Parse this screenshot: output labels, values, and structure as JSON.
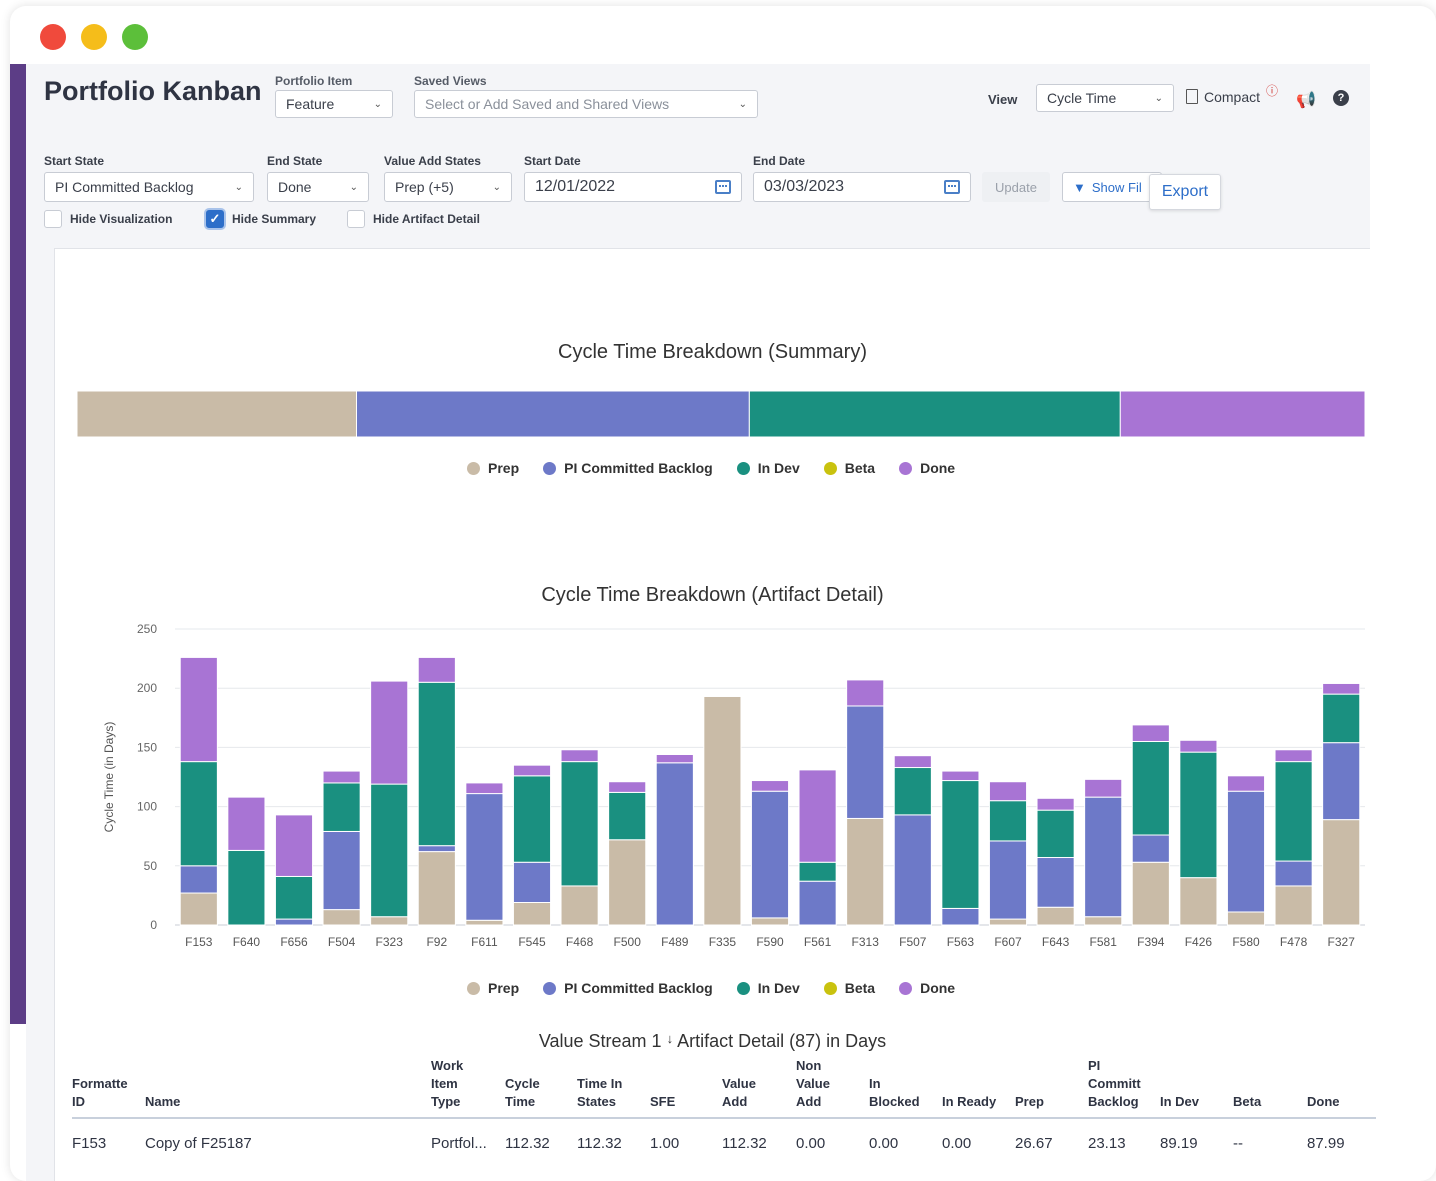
{
  "header": {
    "title": "Portfolio Kanban",
    "portfolio_item_label": "Portfolio Item",
    "portfolio_item_value": "Feature",
    "saved_views_label": "Saved Views",
    "saved_views_placeholder": "Select or Add Saved and Shared Views",
    "view_label": "View",
    "view_value": "Cycle Time",
    "compact_label": "Compact"
  },
  "filters": {
    "start_state_label": "Start State",
    "start_state_value": "PI Committed Backlog",
    "end_state_label": "End State",
    "end_state_value": "Done",
    "value_add_label": "Value Add States",
    "value_add_value": "Prep (+5)",
    "start_date_label": "Start Date",
    "start_date_value": "12/01/2022",
    "end_date_label": "End Date",
    "end_date_value": "03/03/2023",
    "update_label": "Update",
    "show_filters_label": "Show Fil",
    "export_label": "Export",
    "hide_visualization_label": "Hide Visualization",
    "hide_summary_label": "Hide Summary",
    "hide_artifact_label": "Hide Artifact Detail",
    "hide_visualization_checked": false,
    "hide_summary_checked": true,
    "hide_artifact_checked": false
  },
  "colors": {
    "prep": "#c9bba7",
    "pi_committed_backlog": "#6d79c8",
    "in_dev": "#1a9080",
    "beta": "#c9c20f",
    "done": "#a874d4"
  },
  "legend": [
    "Prep",
    "PI Committed Backlog",
    "In Dev",
    "Beta",
    "Done"
  ],
  "chart_data": [
    {
      "type": "bar",
      "title": "Cycle Time Breakdown (Summary)",
      "orientation": "horizontal-stacked-100",
      "series": [
        {
          "name": "Prep",
          "values": [
            21.7
          ]
        },
        {
          "name": "PI Committed Backlog",
          "values": [
            30.5
          ]
        },
        {
          "name": "In Dev",
          "values": [
            28.8
          ]
        },
        {
          "name": "Beta",
          "values": [
            0
          ]
        },
        {
          "name": "Done",
          "values": [
            19.0
          ]
        }
      ],
      "legend": "bottom"
    },
    {
      "type": "bar",
      "title": "Cycle Time Breakdown (Artifact Detail)",
      "ylabel": "Cycle Time (in Days)",
      "ylim": [
        0,
        250
      ],
      "yticks": [
        0,
        50,
        100,
        150,
        200,
        250
      ],
      "categories": [
        "F153",
        "F640",
        "F656",
        "F504",
        "F323",
        "F92",
        "F611",
        "F545",
        "F468",
        "F500",
        "F489",
        "F335",
        "F590",
        "F561",
        "F313",
        "F507",
        "F563",
        "F607",
        "F643",
        "F581",
        "F394",
        "F426",
        "F580",
        "F478",
        "F327"
      ],
      "series": [
        {
          "name": "Prep",
          "values": [
            27,
            0,
            0,
            13,
            7,
            62,
            4,
            19,
            33,
            72,
            0,
            193,
            6,
            0,
            90,
            0,
            0,
            5,
            15,
            7,
            53,
            40,
            11,
            33,
            89
          ]
        },
        {
          "name": "PI Committed Backlog",
          "values": [
            23,
            0,
            5,
            66,
            0,
            5,
            107,
            34,
            0,
            0,
            137,
            0,
            107,
            37,
            95,
            93,
            14,
            66,
            42,
            101,
            23,
            0,
            102,
            21,
            65
          ]
        },
        {
          "name": "In Dev",
          "values": [
            88,
            63,
            36,
            41,
            112,
            138,
            0,
            73,
            105,
            40,
            0,
            0,
            0,
            16,
            0,
            40,
            108,
            34,
            40,
            0,
            79,
            106,
            0,
            84,
            41
          ]
        },
        {
          "name": "Beta",
          "values": [
            0,
            0,
            0,
            0,
            0,
            0,
            0,
            0,
            0,
            0,
            0,
            0,
            0,
            0,
            0,
            0,
            0,
            0,
            0,
            0,
            0,
            0,
            0,
            0,
            0
          ]
        },
        {
          "name": "Done",
          "values": [
            88,
            45,
            52,
            10,
            87,
            21,
            9,
            9,
            10,
            9,
            7,
            0,
            9,
            78,
            22,
            10,
            8,
            16,
            10,
            15,
            14,
            10,
            13,
            10,
            9
          ]
        }
      ],
      "grid": true,
      "legend": "bottom"
    }
  ],
  "table": {
    "title_prefix": "Value Stream 1",
    "title_suffix": "Artifact Detail (87) in Days",
    "sort_arrow": "↓",
    "columns": [
      [
        "Formatte",
        "ID"
      ],
      [
        "Name"
      ],
      [
        "Work",
        "Item",
        "Type"
      ],
      [
        "Cycle",
        "Time"
      ],
      [
        "Time In",
        "States"
      ],
      [
        "SFE"
      ],
      [
        "Value",
        "Add"
      ],
      [
        "Non",
        "Value",
        "Add"
      ],
      [
        "In",
        "Blocked"
      ],
      [
        "In Ready"
      ],
      [
        "Prep"
      ],
      [
        "PI",
        "Committ",
        "Backlog"
      ],
      [
        "In Dev"
      ],
      [
        "Beta"
      ],
      [
        "Done"
      ]
    ],
    "rows": [
      [
        "F153",
        "Copy of F25187",
        "Portfol...",
        "112.32",
        "112.32",
        "1.00",
        "112.32",
        "0.00",
        "0.00",
        "0.00",
        "26.67",
        "23.13",
        "89.19",
        "--",
        "87.99"
      ]
    ]
  }
}
